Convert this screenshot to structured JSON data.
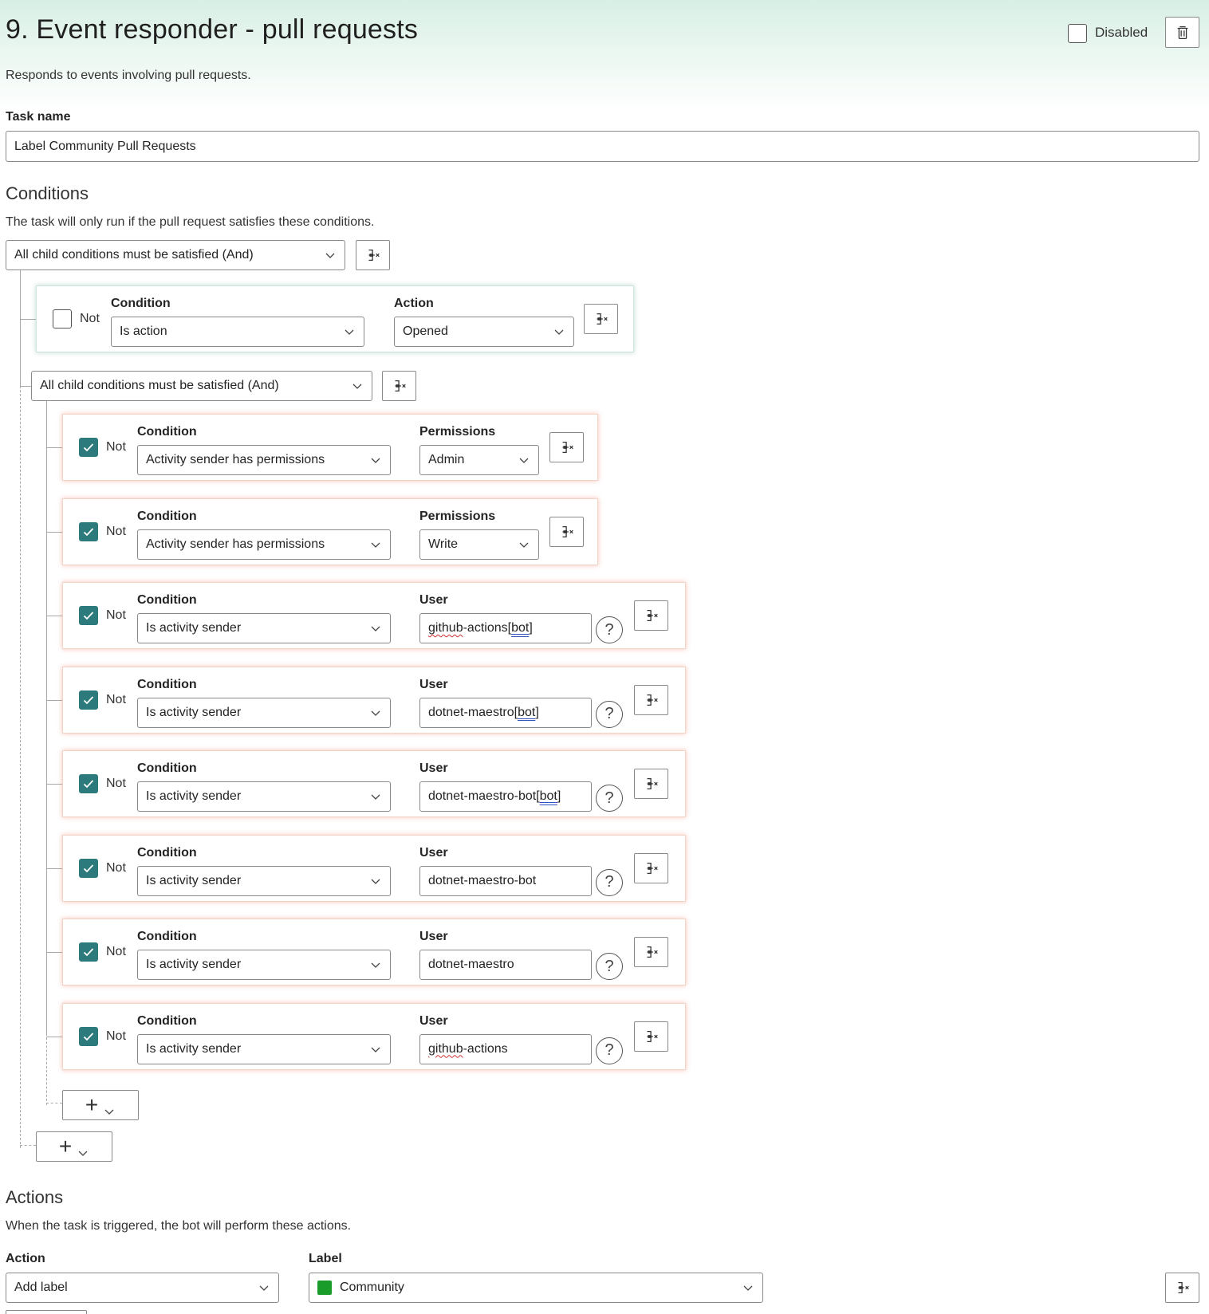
{
  "header": {
    "title": "9. Event responder - pull requests",
    "subtitle": "Responds to events involving pull requests.",
    "disabled_label": "Disabled"
  },
  "task": {
    "label": "Task name",
    "value": "Label Community Pull Requests"
  },
  "conditions": {
    "title": "Conditions",
    "description": "The task will only run if the pull request satisfies these conditions.",
    "root_operator": "All child conditions must be satisfied (And)",
    "first": {
      "not_label": "Not",
      "not_checked": false,
      "condition_label": "Condition",
      "condition_value": "Is action",
      "param_label": "Action",
      "param_value": "Opened"
    },
    "nested_operator": "All child conditions must be satisfied (And)",
    "nested": [
      {
        "not_label": "Not",
        "condition_label": "Condition",
        "condition_value": "Activity sender has permissions",
        "param_label": "Permissions",
        "param_value": "Admin",
        "type": "select"
      },
      {
        "not_label": "Not",
        "condition_label": "Condition",
        "condition_value": "Activity sender has permissions",
        "param_label": "Permissions",
        "param_value": "Write",
        "type": "select"
      },
      {
        "not_label": "Not",
        "condition_label": "Condition",
        "condition_value": "Is activity sender",
        "param_label": "User",
        "param_value": "github-actions[bot]",
        "type": "input"
      },
      {
        "not_label": "Not",
        "condition_label": "Condition",
        "condition_value": "Is activity sender",
        "param_label": "User",
        "param_value": "dotnet-maestro[bot]",
        "type": "input"
      },
      {
        "not_label": "Not",
        "condition_label": "Condition",
        "condition_value": "Is activity sender",
        "param_label": "User",
        "param_value": "dotnet-maestro-bot[bot]",
        "type": "input"
      },
      {
        "not_label": "Not",
        "condition_label": "Condition",
        "condition_value": "Is activity sender",
        "param_label": "User",
        "param_value": "dotnet-maestro-bot",
        "type": "input"
      },
      {
        "not_label": "Not",
        "condition_label": "Condition",
        "condition_value": "Is activity sender",
        "param_label": "User",
        "param_value": "dotnet-maestro",
        "type": "input"
      },
      {
        "not_label": "Not",
        "condition_label": "Condition",
        "condition_value": "Is activity sender",
        "param_label": "User",
        "param_value": "github-actions",
        "type": "input"
      }
    ],
    "help_glyph": "?"
  },
  "actions": {
    "title": "Actions",
    "description": "When the task is triggered, the bot will perform these actions.",
    "action_label": "Action",
    "action_value": "Add label",
    "label_label": "Label",
    "label_value": "Community",
    "label_color": "#1a9c2a"
  },
  "icons": [
    "delete-icon",
    "remove-condition-icon",
    "chevron-down-icon",
    "checkmark-icon",
    "help-icon",
    "plus-icon"
  ]
}
